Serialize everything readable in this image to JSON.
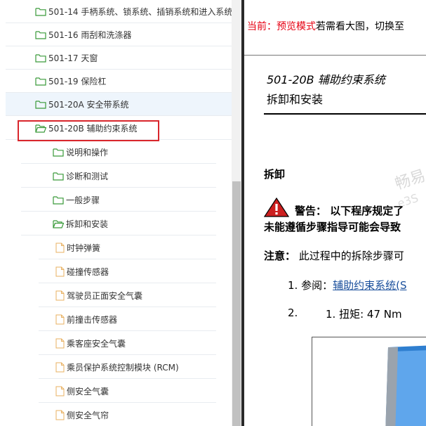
{
  "tree": {
    "items": [
      {
        "label": "501-14 手柄系统、锁系统、插销系统和进入系统",
        "icon": "folder-icon"
      },
      {
        "label": "501-16 雨刮和洗涤器",
        "icon": "folder-icon"
      },
      {
        "label": "501-17 天窗",
        "icon": "folder-icon"
      },
      {
        "label": "501-19 保险杠",
        "icon": "folder-icon"
      },
      {
        "label": "501-20A 安全带系统",
        "icon": "folder-icon"
      },
      {
        "label": "501-20B 辅助约束系统",
        "icon": "folder-open-icon"
      },
      {
        "label": "说明和操作",
        "icon": "folder-icon"
      },
      {
        "label": "诊断和测试",
        "icon": "folder-icon"
      },
      {
        "label": "一般步骤",
        "icon": "folder-icon"
      },
      {
        "label": "拆卸和安装",
        "icon": "folder-open-icon"
      },
      {
        "label": "时钟弹簧",
        "icon": "document-icon"
      },
      {
        "label": "碰撞传感器",
        "icon": "document-icon"
      },
      {
        "label": "驾驶员正面安全气囊",
        "icon": "document-icon"
      },
      {
        "label": "前撞击传感器",
        "icon": "document-icon"
      },
      {
        "label": "乘客座安全气囊",
        "icon": "document-icon"
      },
      {
        "label": "乘员保护系统控制模块 (RCM)",
        "icon": "document-icon"
      },
      {
        "label": "侧安全气囊",
        "icon": "document-icon"
      },
      {
        "label": "侧安全气帘",
        "icon": "document-icon"
      }
    ]
  },
  "preview": {
    "notice_red": "当前：预览模式",
    "notice_rest": "若需看大图，切换至",
    "doc_title": "501-20B 辅助约束系统",
    "doc_subtitle": "拆卸和安装",
    "section_remove": "拆卸",
    "warning_line1": "警告： 以下程序规定了",
    "warning_line2": "未能遵循步骤指导可能会导致",
    "note_label": "注意：",
    "note_text": " 此过程中的拆除步骤可",
    "step1_prefix": "1. 参阅：",
    "step1_link": "辅助约束系统(S",
    "step2_num": "2.",
    "step2_text": "1. 扭矩: 47 Nm",
    "watermark_1": "畅易",
    "watermark_2": "e3S"
  },
  "colors": {
    "accent_red": "#e60012",
    "folder_green": "#3a9a3a",
    "selection_border": "#d9262c",
    "link_blue": "#1a4f9c"
  }
}
